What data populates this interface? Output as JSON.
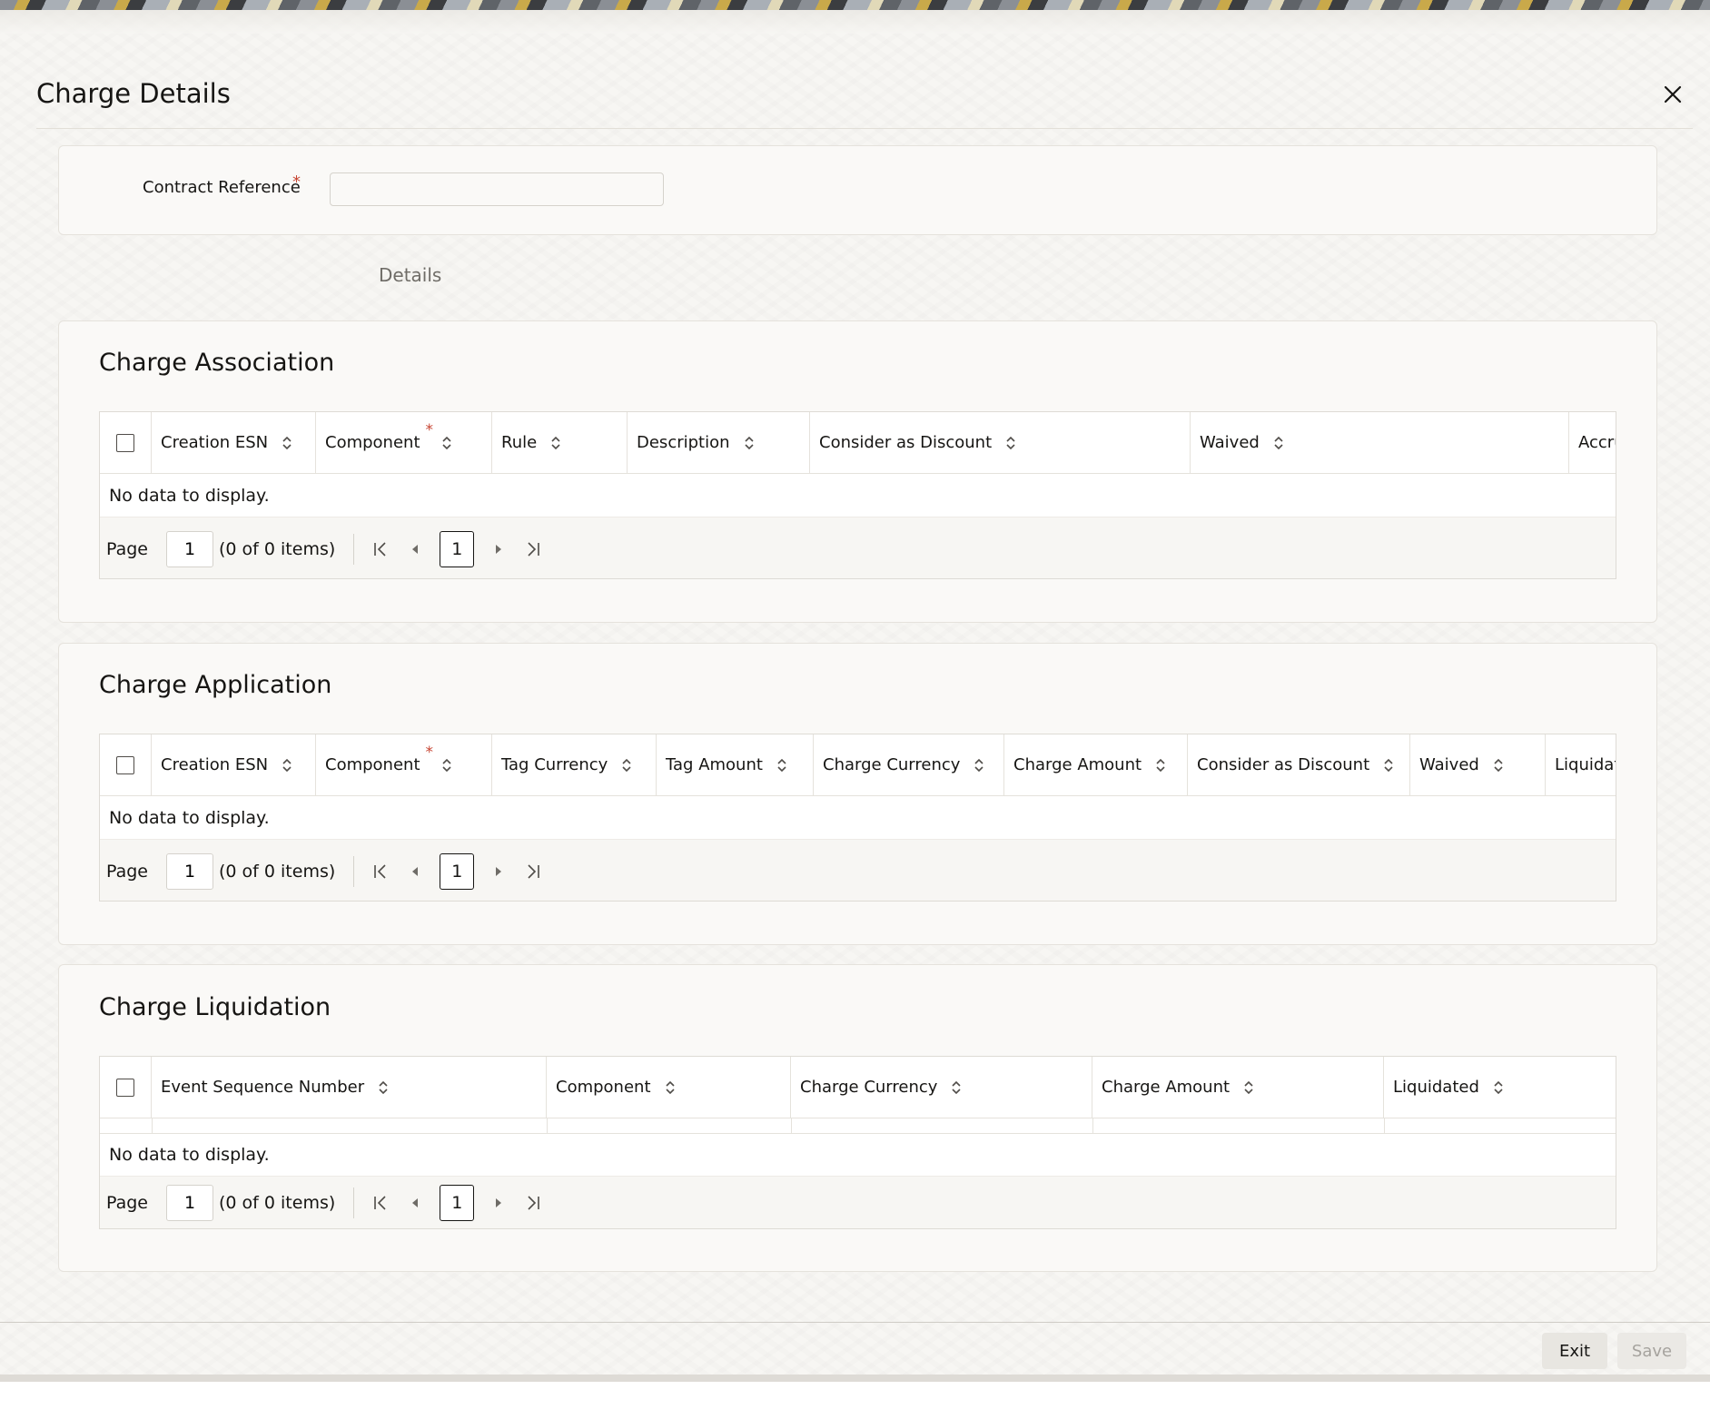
{
  "window": {
    "title": "Charge Details"
  },
  "header": {
    "contract_reference_label": "Contract Reference",
    "required_mark": "*",
    "contract_reference_value": ""
  },
  "tabs": [
    {
      "label": "Details"
    }
  ],
  "charge_association": {
    "title": "Charge Association",
    "columns": [
      "Creation ESN",
      "Component",
      "Rule",
      "Description",
      "Consider as Discount",
      "Waived",
      "Accru"
    ],
    "empty_message": "No data to display.",
    "pager": {
      "page_label": "Page",
      "page_value": "1",
      "items_text": "(0 of 0 items)",
      "current_page": "1"
    }
  },
  "charge_application": {
    "title": "Charge Application",
    "columns": [
      "Creation ESN",
      "Component",
      "Tag Currency",
      "Tag Amount",
      "Charge Currency",
      "Charge Amount",
      "Consider as Discount",
      "Waived",
      "Liquidat"
    ],
    "empty_message": "No data to display.",
    "pager": {
      "page_label": "Page",
      "page_value": "1",
      "items_text": "(0 of 0 items)",
      "current_page": "1"
    }
  },
  "charge_liquidation": {
    "title": "Charge Liquidation",
    "columns": [
      "Event Sequence Number",
      "Component",
      "Charge Currency",
      "Charge Amount",
      "Liquidated"
    ],
    "empty_message": "No data to display.",
    "pager": {
      "page_label": "Page",
      "page_value": "1",
      "items_text": "(0 of 0 items)",
      "current_page": "1"
    }
  },
  "footer": {
    "exit_label": "Exit",
    "save_label": "Save"
  },
  "icons": {
    "close": "close-icon",
    "sort": "sort-icon",
    "first": "first-page-icon",
    "prev": "previous-page-icon",
    "next": "next-page-icon",
    "last": "last-page-icon"
  },
  "colors": {
    "required": "#c74634",
    "text": "#161513",
    "muted": "#6f6c67"
  }
}
